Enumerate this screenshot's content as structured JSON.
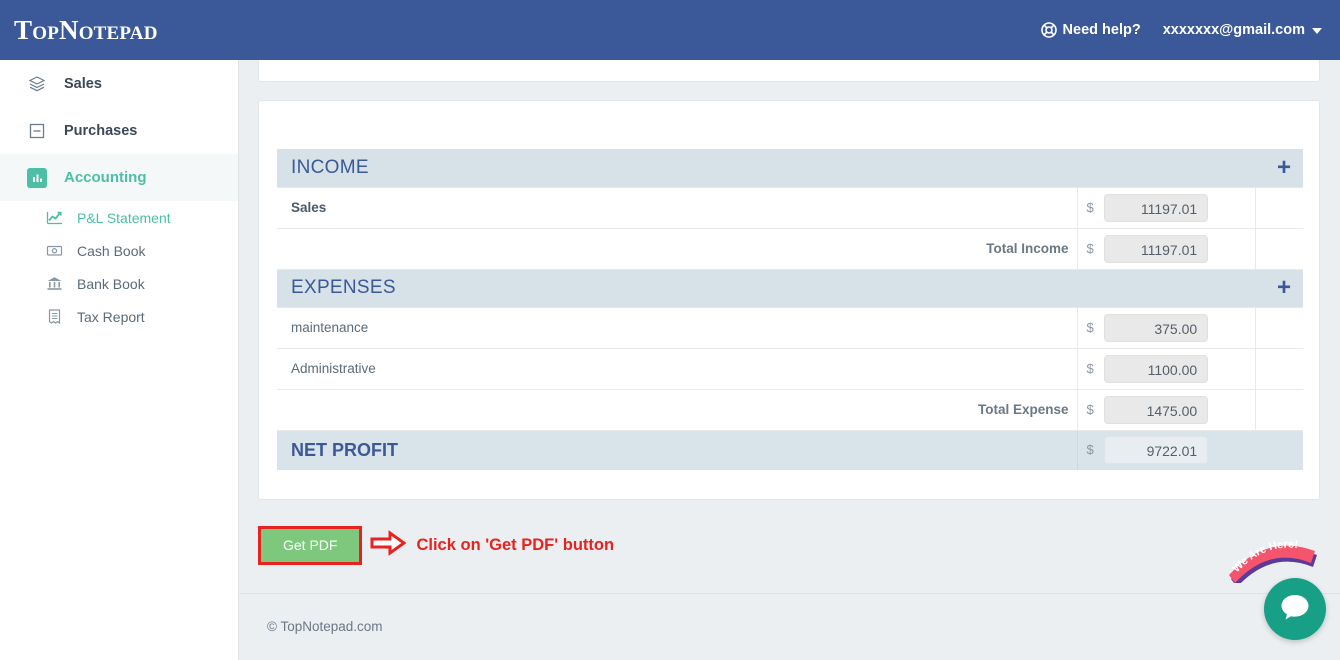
{
  "header": {
    "brand": "TopNotepad",
    "need_help": "Need help?",
    "help_icon": "lifebuoy-icon",
    "user_email": "xxxxxxx@gmail.com",
    "caret_icon": "caret-down-icon"
  },
  "sidebar": {
    "items": [
      {
        "label": "Sales",
        "icon": "layers-icon",
        "active": false
      },
      {
        "label": "Purchases",
        "icon": "minus-square-icon",
        "active": false
      },
      {
        "label": "Accounting",
        "icon": "bar-chart-icon",
        "active": true
      }
    ],
    "subitems": [
      {
        "label": "P&L Statement",
        "icon": "line-chart-icon",
        "active": true
      },
      {
        "label": "Cash Book",
        "icon": "money-bill-icon",
        "active": false
      },
      {
        "label": "Bank Book",
        "icon": "bank-icon",
        "active": false
      },
      {
        "label": "Tax Report",
        "icon": "receipt-icon",
        "active": false
      }
    ]
  },
  "statement": {
    "currency": "$",
    "income": {
      "title": "INCOME",
      "add_icon": "plus-icon",
      "rows": [
        {
          "label": "Sales",
          "amount": "11197.01"
        }
      ],
      "total_label": "Total Income",
      "total_amount": "11197.01"
    },
    "expenses": {
      "title": "EXPENSES",
      "add_icon": "plus-icon",
      "rows": [
        {
          "label": "maintenance",
          "amount": "375.00"
        },
        {
          "label": "Administrative",
          "amount": "1100.00"
        }
      ],
      "total_label": "Total Expense",
      "total_amount": "1475.00"
    },
    "net_profit": {
      "title": "NET PROFIT",
      "amount": "9722.01"
    }
  },
  "actions": {
    "get_pdf_label": "Get PDF",
    "annotation": "Click on 'Get PDF' button",
    "annotation_color": "#e8231f",
    "arrow_icon": "arrow-right-icon"
  },
  "footer": {
    "copyright": "© TopNotepad.com"
  },
  "chat": {
    "banner_text": "We Are Here!",
    "bubble_icon": "chat-bubble-icon",
    "bubble_color": "#17a085",
    "banner_color": "#f4556d"
  },
  "colors": {
    "header_blue": "#3b5998",
    "accent_green": "#4cbfa6",
    "section_band": "#d6e1e8",
    "pdf_green": "#7dc87d"
  }
}
